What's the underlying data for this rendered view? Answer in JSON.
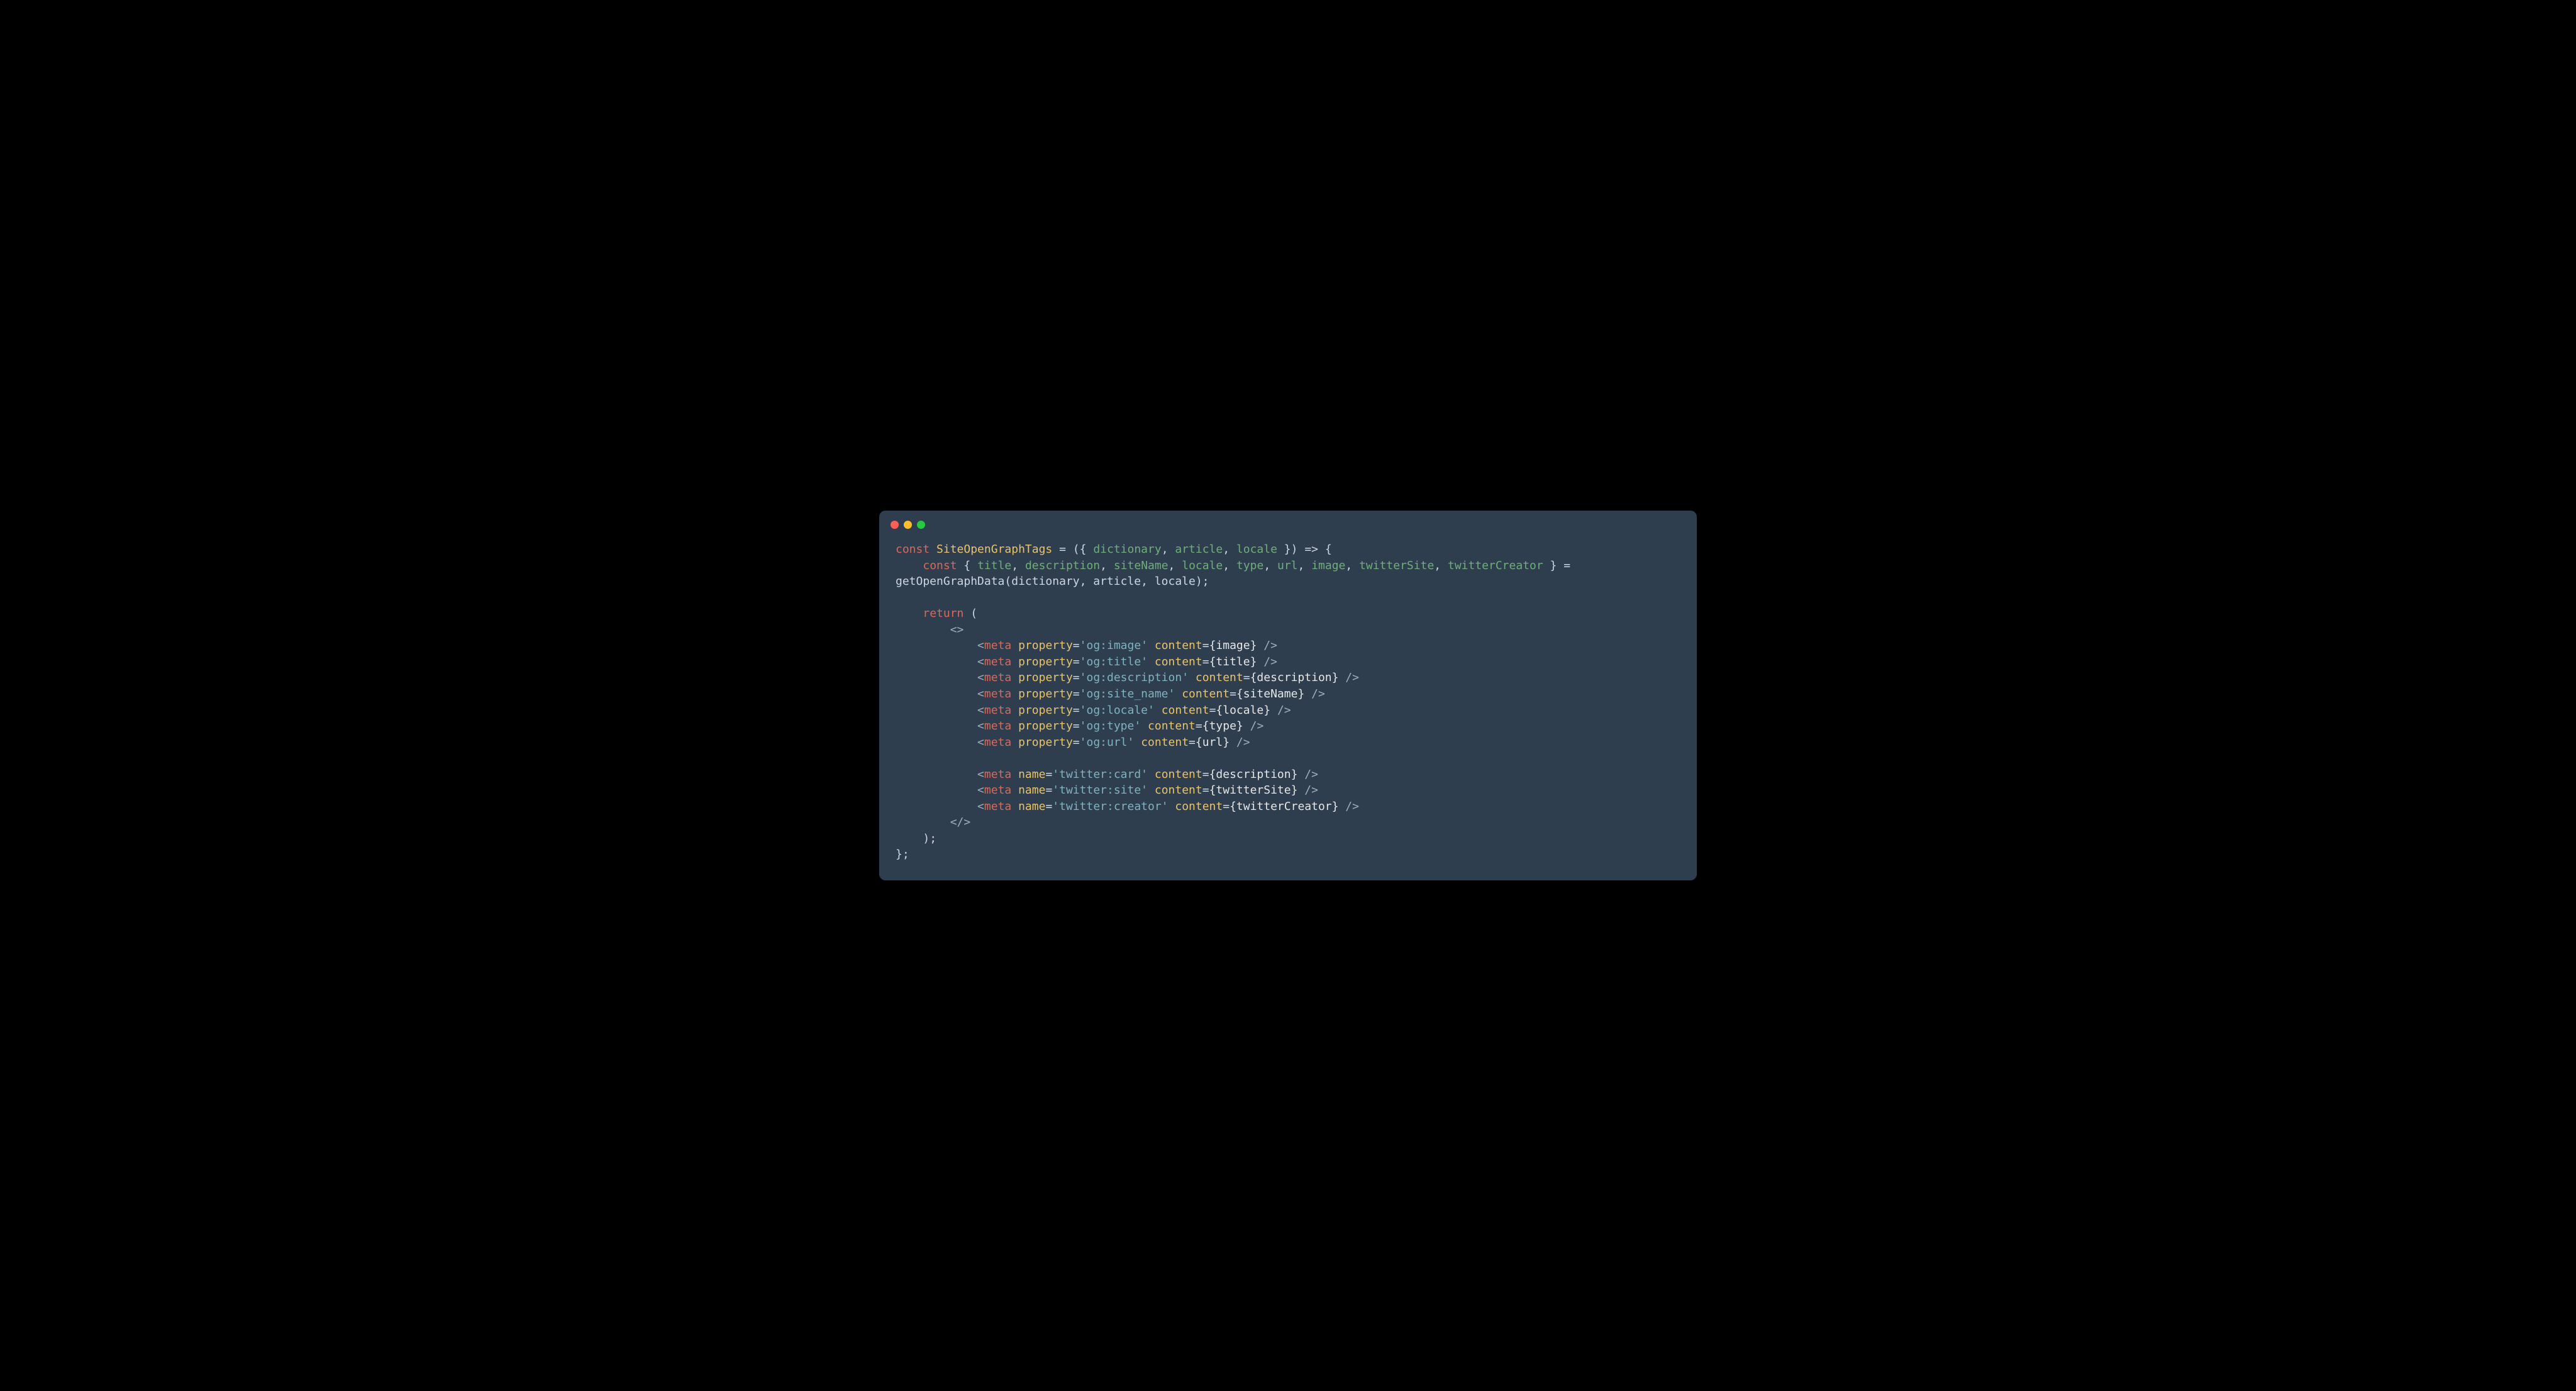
{
  "code": {
    "l1_const": "const",
    "l1_name": "SiteOpenGraphTags",
    "l1_eq": " = (",
    "l1_b1": "{ ",
    "l1_d": "dictionary",
    "l1_c1": ", ",
    "l1_a": "article",
    "l1_c2": ", ",
    "l1_l": "locale",
    "l1_b2": " }",
    "l1_end": ") => {",
    "l2_const": "const",
    "l2_b1": " { ",
    "l2_title": "title",
    "l2_c1": ", ",
    "l2_desc": "description",
    "l2_c2": ", ",
    "l2_sn": "siteName",
    "l2_c3": ", ",
    "l2_loc": "locale",
    "l2_c4": ", ",
    "l2_type": "type",
    "l2_c5": ", ",
    "l2_url": "url",
    "l2_c6": ", ",
    "l2_img": "image",
    "l2_c7": ", ",
    "l2_ts": "twitterSite",
    "l2_c8": ", ",
    "l2_tc": "twitterCreator",
    "l2_b2": " } = ",
    "l3": "getOpenGraphData(dictionary, article, locale);",
    "l5_return": "return",
    "l5_open": " (",
    "l6_frag": "<>",
    "m1_prop": "'og:image'",
    "m1_var": "{image}",
    "m2_prop": "'og:title'",
    "m2_var": "{title}",
    "m3_prop": "'og:description'",
    "m3_var": "{description}",
    "m4_prop": "'og:site_name'",
    "m4_var": "{siteName}",
    "m5_prop": "'og:locale'",
    "m5_var": "{locale}",
    "m6_prop": "'og:type'",
    "m6_var": "{type}",
    "m7_prop": "'og:url'",
    "m7_var": "{url}",
    "t1_name": "'twitter:card'",
    "t1_var": "{description}",
    "t2_name": "'twitter:site'",
    "t2_var": "{twitterSite}",
    "t3_name": "'twitter:creator'",
    "t3_var": "{twitterCreator}",
    "tag_open": "<",
    "tag_meta": "meta",
    "attr_property": "property",
    "attr_name": "name",
    "attr_content": "content",
    "eq": "=",
    "tag_close": " />",
    "frag_close": "</>",
    "paren_close": ");",
    "brace_close": "};"
  }
}
